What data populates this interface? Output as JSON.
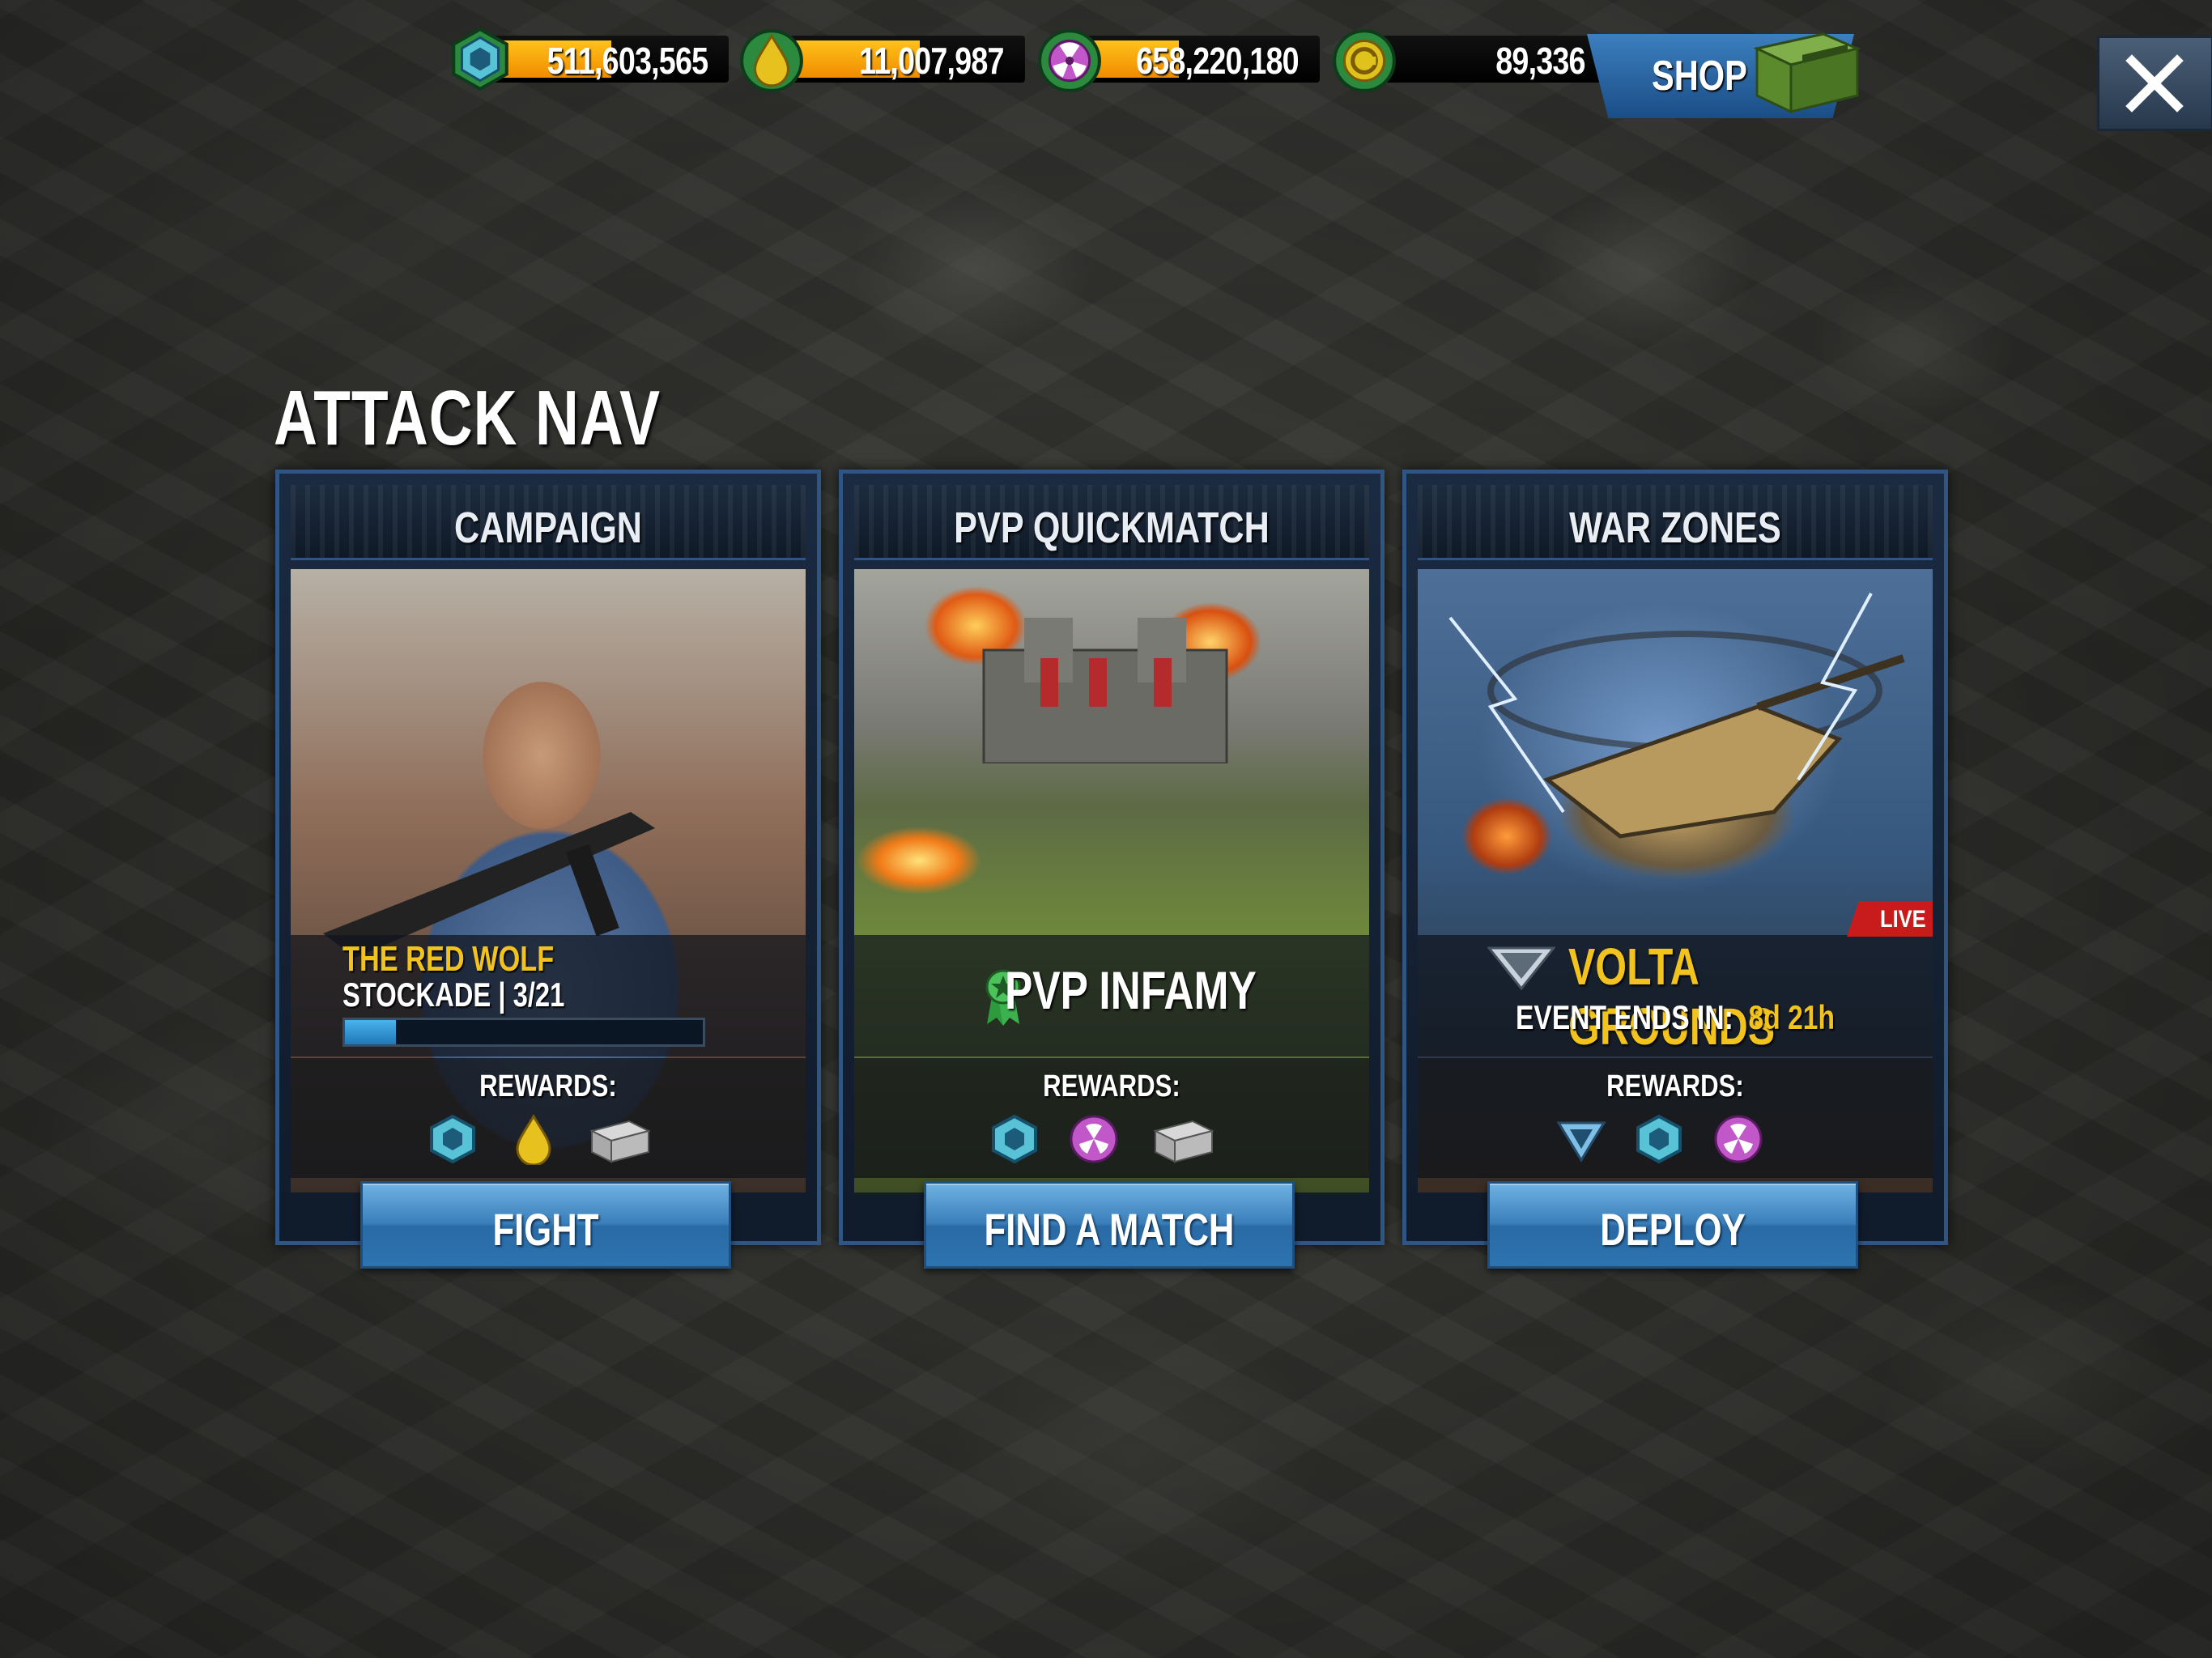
{
  "resources": [
    {
      "id": "alloy",
      "value": "511,603,565",
      "icon": "hex-alloy-icon",
      "color": "#58c3d6"
    },
    {
      "id": "oil",
      "value": "11,007,987",
      "icon": "oil-drop-icon",
      "color": "#e7c21e"
    },
    {
      "id": "uranium",
      "value": "658,220,180",
      "icon": "uranium-icon",
      "color": "#c157c9"
    },
    {
      "id": "gold",
      "value": "89,336",
      "icon": "gold-coin-icon",
      "color": "#e0c21c"
    }
  ],
  "shop": {
    "label": "SHOP",
    "icon": "supply-crate-icon"
  },
  "close": {
    "icon": "close-icon"
  },
  "title": "ATTACK NAV",
  "cards": {
    "campaign": {
      "header": "CAMPAIGN",
      "name": "THE RED WOLF",
      "sub": "STOCKADE | 3/21",
      "progress": 0.143,
      "rewards_label": "REWARDS:",
      "rewards": [
        "hex-alloy-icon",
        "oil-drop-icon",
        "supply-crate-icon"
      ],
      "button": "FIGHT"
    },
    "pvp": {
      "header": "PVP QUICKMATCH",
      "title": "PVP INFAMY",
      "rewards_label": "REWARDS:",
      "rewards": [
        "hex-alloy-icon",
        "uranium-icon",
        "supply-crate-icon"
      ],
      "button": "FIND A MATCH"
    },
    "war": {
      "header": "WAR ZONES",
      "badge": "LIVE",
      "name": "VOLTA GROUNDS",
      "ends_label": "EVENT ENDS IN:",
      "ends_time": "8d 21h",
      "rewards_label": "REWARDS:",
      "rewards": [
        "war-token-icon",
        "hex-alloy-icon",
        "uranium-icon"
      ],
      "button": "DEPLOY"
    }
  },
  "colors": {
    "accent_blue": "#2f5584",
    "button_blue": "#3a7fbb",
    "highlight_yellow": "#f2c21d",
    "live_red": "#c81c1c",
    "resource_fill": "#f5a40a"
  }
}
